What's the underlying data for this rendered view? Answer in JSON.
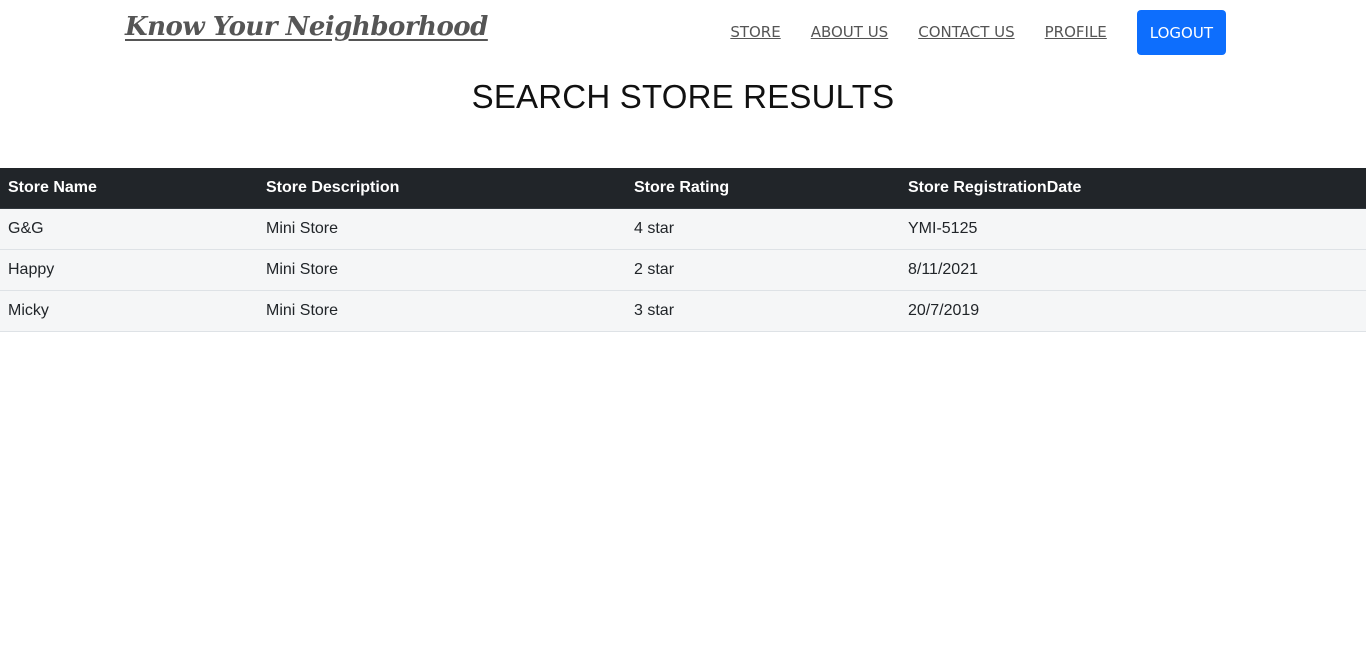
{
  "navbar": {
    "brand": "Know Your Neighborhood",
    "links": [
      "STORE",
      "ABOUT US",
      "CONTACT US",
      "PROFILE"
    ],
    "logout_label": "LOGOUT"
  },
  "main": {
    "title": "SEARCH STORE RESULTS"
  },
  "table": {
    "headers": [
      "Store Name",
      "Store Description",
      "Store Rating",
      "Store RegistrationDate"
    ],
    "rows": [
      [
        "G&G",
        "Mini Store",
        "4 star",
        "YMI-5125"
      ],
      [
        "Happy",
        "Mini Store",
        "2 star",
        "8/11/2021"
      ],
      [
        "Micky",
        "Mini Store",
        "3 star",
        "20/7/2019"
      ]
    ]
  },
  "colors": {
    "accent": "#0d6efd",
    "table_header_bg": "#212529",
    "row_bg": "#f5f6f7",
    "link_text": "#555555"
  }
}
